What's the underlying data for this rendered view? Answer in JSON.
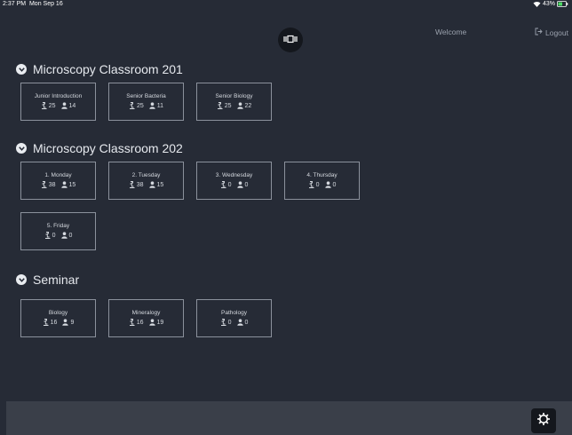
{
  "status_bar": {
    "time": "2:37 PM",
    "date": "Mon Sep 16",
    "battery": "43%"
  },
  "header": {
    "camera_icon": "microscope-camera-icon",
    "welcome": "Welcome",
    "logout": "Logout"
  },
  "sections": [
    {
      "title": "Microscopy Classroom 201",
      "tiles": [
        {
          "name": "Junior Introduction",
          "slides": "25",
          "users": "14"
        },
        {
          "name": "Senior Bacteria",
          "slides": "25",
          "users": "11"
        },
        {
          "name": "Senior Biology",
          "slides": "25",
          "users": "22"
        }
      ]
    },
    {
      "title": "Microscopy Classroom 202",
      "tiles": [
        {
          "name": "1. Monday",
          "slides": "38",
          "users": "15"
        },
        {
          "name": "2. Tuesday",
          "slides": "38",
          "users": "15"
        },
        {
          "name": "3. Wednesday",
          "slides": "0",
          "users": "0"
        },
        {
          "name": "4. Thursday",
          "slides": "0",
          "users": "0"
        },
        {
          "name": "5. Friday",
          "slides": "0",
          "users": "0"
        }
      ]
    },
    {
      "title": "Seminar",
      "tiles": [
        {
          "name": "Biology",
          "slides": "16",
          "users": "9"
        },
        {
          "name": "Mineralogy",
          "slides": "16",
          "users": "19"
        },
        {
          "name": "Pathology",
          "slides": "0",
          "users": "0"
        }
      ]
    }
  ],
  "colors": {
    "background": "#262b36",
    "tile_border": "#8b919c",
    "bottom_bar": "#3a3f49",
    "button_dark": "#14171d",
    "battery_green": "#4cd964"
  },
  "icons": {
    "slide": "microscope-slide-icon",
    "user": "user-icon",
    "section_toggle": "chevron-down-circle-icon",
    "settings": "gear-icon",
    "logout": "logout-icon"
  }
}
